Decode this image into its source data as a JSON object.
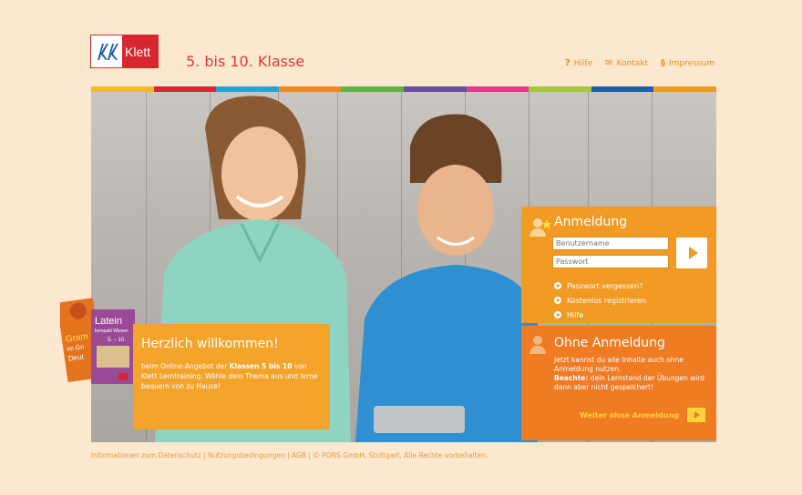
{
  "header": {
    "logo_text": "Klett",
    "site_title": "5. bis 10. Klasse",
    "nav": [
      {
        "label": "Hilfe",
        "icon": "question-icon"
      },
      {
        "label": "Kontakt",
        "icon": "envelope-icon"
      },
      {
        "label": "Impressum",
        "icon": "paragraph-icon"
      }
    ]
  },
  "stripe_colors": [
    "#f6bb1f",
    "#d8262e",
    "#27a1d9",
    "#f08a1c",
    "#5bb543",
    "#6a4c9c",
    "#e4398b",
    "#a6c93a",
    "#1d5fa8",
    "#f19b24"
  ],
  "welcome": {
    "title": "Herzlich willkommen!",
    "text_pre": "beim Online-Angebot der ",
    "text_bold": "Klassen 5 bis 10",
    "text_post": " von Klett Lerntraining. Wähle dein Thema aus und lerne bequem von zu Hause!"
  },
  "books": {
    "front_title": "Latein",
    "front_subtitle": "kompakt Wissen",
    "front_grade": "5. – 10.",
    "back_title": "Gram",
    "back_line2": "im Gri",
    "back_line3": "Deut"
  },
  "login": {
    "title": "Anmeldung",
    "username_placeholder": "Benutzername",
    "password_placeholder": "Passwort",
    "links": [
      "Passwort vergessen?",
      "Kostenlos registrieren",
      "Hilfe"
    ]
  },
  "guest": {
    "title": "Ohne Anmeldung",
    "text": "Jetzt kannst du alle Inhalte auch ohne Anmeldung nutzen.",
    "note_bold": "Beachte:",
    "note": " dein Lernstand der Übungen wird dann aber nicht gespeichert!",
    "cta_label": "Weiter ohne Anmeldung"
  },
  "footer": {
    "links": [
      "Informationen zum Datenschutz",
      "Nutzungsbedingungen",
      "AGB",
      "© PONS GmbH, Stuttgart. Alle Rechte vorbehalten."
    ]
  }
}
